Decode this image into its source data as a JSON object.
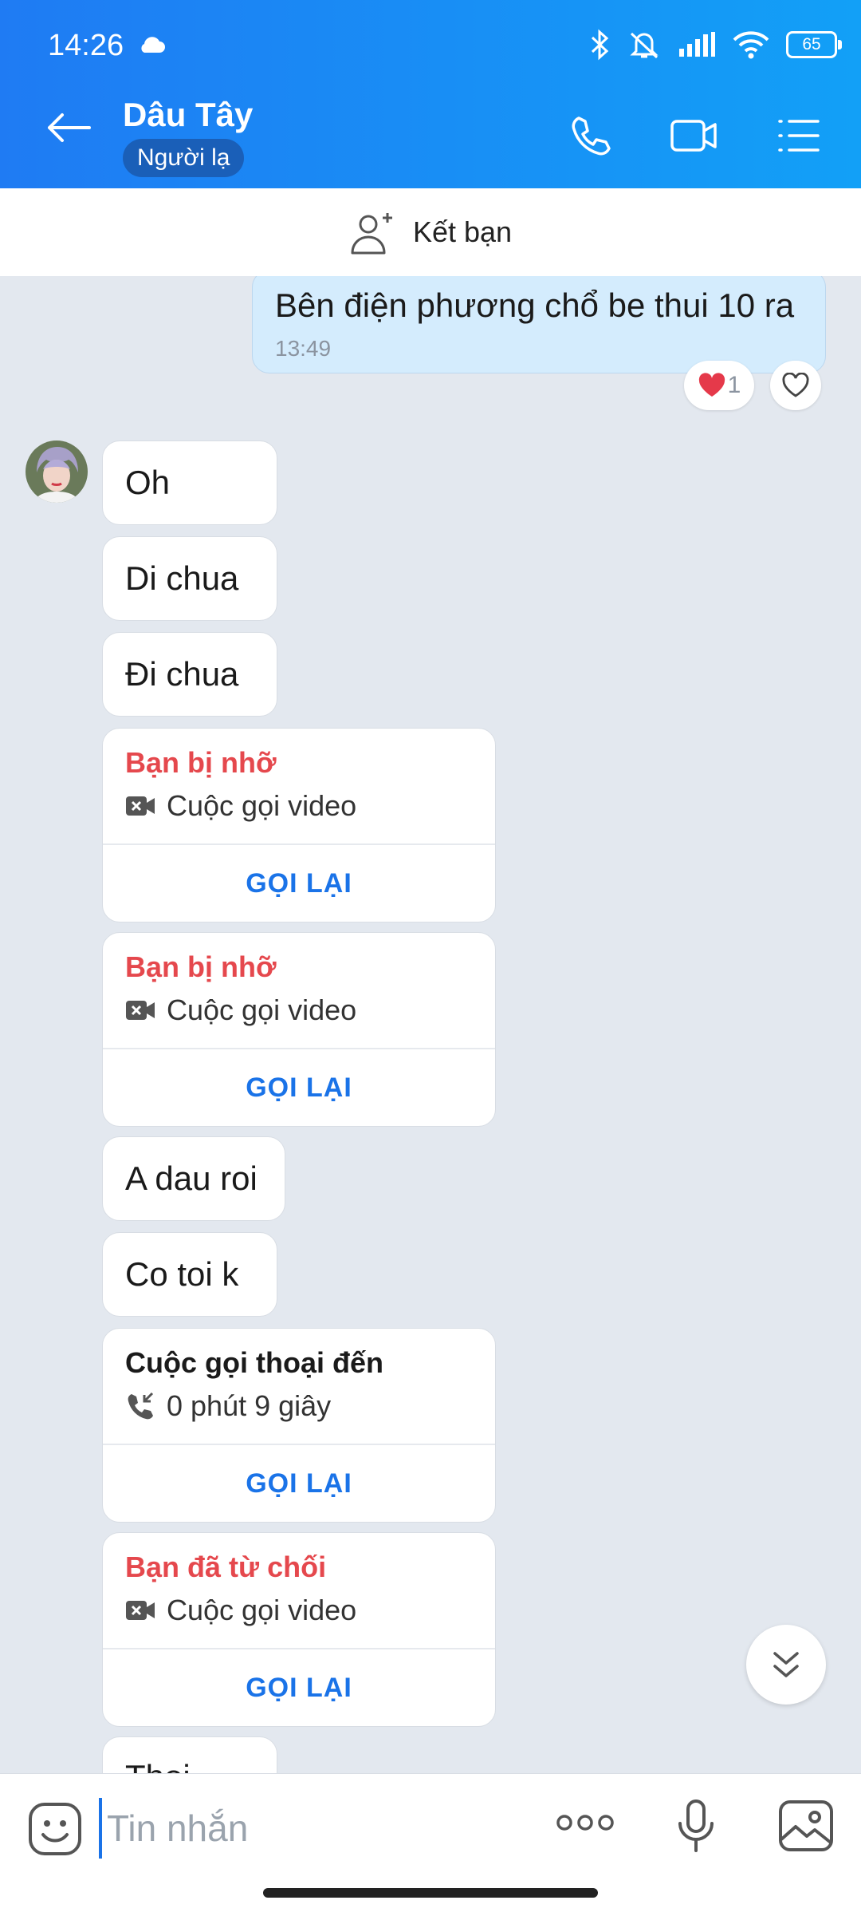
{
  "status": {
    "time": "14:26",
    "battery": "65"
  },
  "header": {
    "contact_name": "Dâu Tây",
    "badge": "Người lạ"
  },
  "friend_bar": {
    "label": "Kết bạn"
  },
  "own_message": {
    "text": "Bên điện phương chổ be thui 10 ra",
    "time": "13:49",
    "reaction_count": "1"
  },
  "messages": [
    "Oh",
    "Di chua",
    "Đi chua",
    "A dau roi",
    "Co toi k",
    "Thoi"
  ],
  "calls": [
    {
      "title": "Bạn bị nhỡ",
      "type": "Cuộc gọi video",
      "action": "GỌI LẠI"
    },
    {
      "title": "Bạn bị nhỡ",
      "type": "Cuộc gọi video",
      "action": "GỌI LẠI"
    },
    {
      "title": "Cuộc gọi thoại đến",
      "type": "0 phút 9 giây",
      "action": "GỌI LẠI"
    },
    {
      "title": "Bạn đã từ chối",
      "type": "Cuộc gọi video",
      "action": "GỌI LẠI"
    }
  ],
  "composer": {
    "placeholder": "Tin nhắn"
  },
  "colors": {
    "header_start": "#1f7bf3",
    "header_end": "#12a0f7",
    "missed": "#e5484d",
    "action": "#1a73e8",
    "own_bubble": "#d4ecfd",
    "chat_bg": "#e3e8ef"
  }
}
